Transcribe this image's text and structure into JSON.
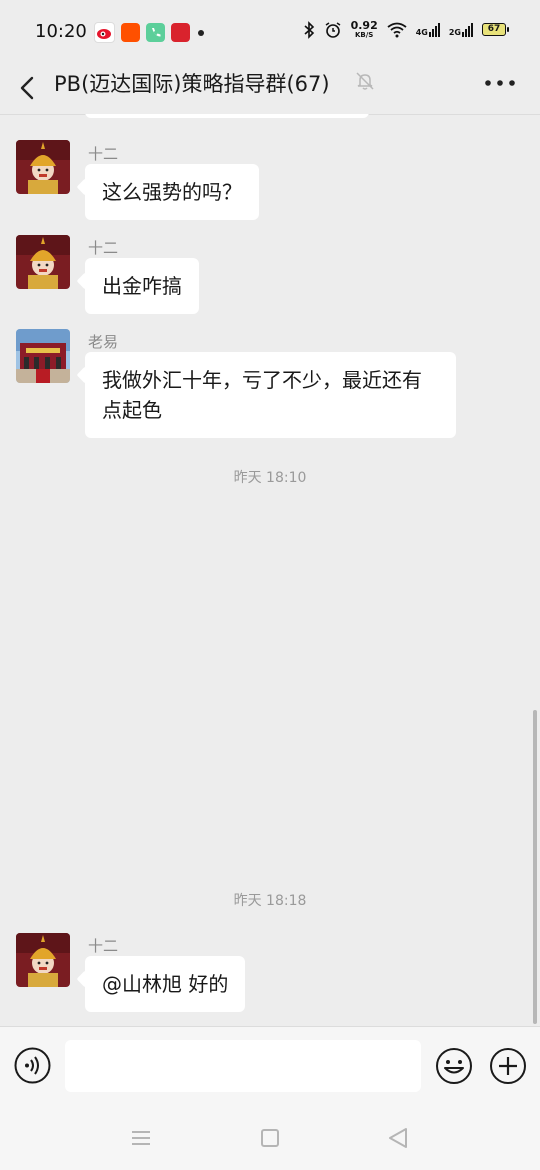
{
  "status_bar": {
    "time": "10:20",
    "speed_value": "0.92",
    "speed_unit": "KB/S",
    "net1": "4G",
    "net2": "2G",
    "battery": "67",
    "app_icons": [
      "weibo-app-icon",
      "taobao-app-icon",
      "phone-app-icon",
      "news-app-icon"
    ]
  },
  "header": {
    "title": "PB(迈达国际)策略指导群(67)"
  },
  "messages": [
    {
      "sender": "十二",
      "text": "这么强势的吗？"
    },
    {
      "sender": "十二",
      "text": "出金咋搞"
    },
    {
      "sender": "老易",
      "text": "我做外汇十年，亏了不少，最近还有点起色"
    },
    {
      "sender": "十二",
      "text": "@山林旭  好的"
    }
  ],
  "timestamps": [
    "昨天 18:10",
    "昨天 18:18"
  ],
  "input": {
    "placeholder": "",
    "value": ""
  },
  "colors": {
    "background": "#ededed",
    "bubble": "#ffffff",
    "timestamp": "#9a9a9a"
  }
}
